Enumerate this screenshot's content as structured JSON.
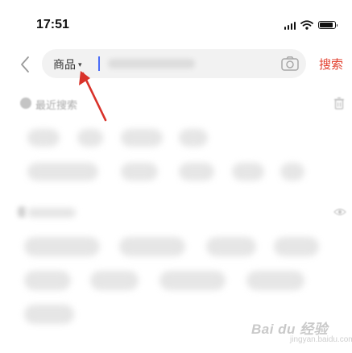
{
  "status_bar": {
    "time": "17:51"
  },
  "search": {
    "category_label": "商品",
    "caret": "▾",
    "submit_label": "搜索"
  },
  "recent": {
    "title": "最近搜索"
  },
  "watermark": {
    "text": "Bai du 经验",
    "sub": "jingyan.baidu.com"
  },
  "colors": {
    "accent": "#e23e2c",
    "cursor": "#4a6cf7",
    "annotation_arrow": "#d9322a"
  },
  "icons": {
    "back": "chevron-left-icon",
    "camera": "camera-icon",
    "trash": "trash-icon",
    "eye": "eye-icon",
    "wifi": "wifi-icon",
    "signal": "signal-icon",
    "battery": "battery-icon"
  }
}
